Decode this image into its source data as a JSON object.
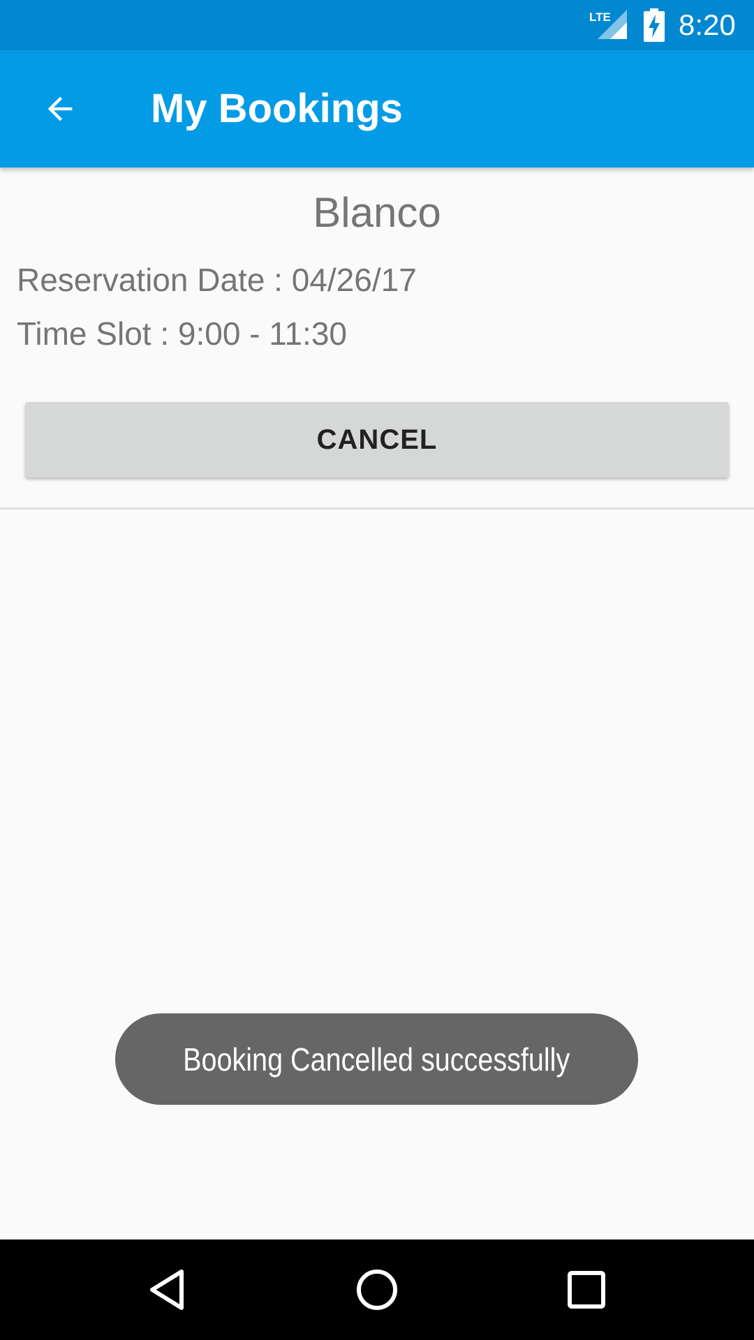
{
  "status_bar": {
    "time": "8:20",
    "network_label": "LTE",
    "icons": [
      "lte-signal-icon",
      "battery-charging-icon"
    ]
  },
  "app_bar": {
    "title": "My Bookings",
    "back_icon": "arrow-back-icon",
    "color": "#039be5"
  },
  "booking": {
    "restaurant_name": "Blanco",
    "reservation_date": "Reservation Date : 04/26/17",
    "time_slot": "Time Slot : 9:00 - 11:30",
    "cancel_label": "CANCEL"
  },
  "toast": {
    "message": "Booking Cancelled successfully"
  },
  "nav_bar": {
    "icons": [
      "nav-back-icon",
      "nav-home-icon",
      "nav-recents-icon"
    ]
  },
  "colors": {
    "status_bar": "#0288d1",
    "app_bar": "#039be5",
    "text_secondary": "#757575",
    "button_bg": "#d6d7d7",
    "toast_bg": "#666666"
  }
}
